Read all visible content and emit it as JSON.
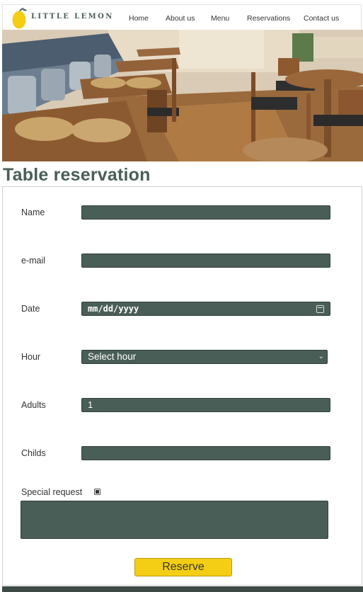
{
  "header": {
    "logo_text": "LITTLE LEMON",
    "nav": [
      "Home",
      "About us",
      "Menu",
      "Reservations",
      "Contact us"
    ]
  },
  "page": {
    "title": "Table reservation"
  },
  "form": {
    "name_label": "Name",
    "name_value": "",
    "email_label": "e-mail",
    "email_value": "",
    "date_label": "Date",
    "date_placeholder": "mm/dd/yyyy",
    "hour_label": "Hour",
    "hour_value": "Select hour",
    "adults_label": "Adults",
    "adults_value": "1",
    "childs_label": "Childs",
    "childs_value": "",
    "special_label": "Special request",
    "special_checked": true,
    "special_text": "",
    "submit_label": "Reserve"
  },
  "colors": {
    "brand_green": "#495e57",
    "brand_yellow": "#f4ce14"
  }
}
